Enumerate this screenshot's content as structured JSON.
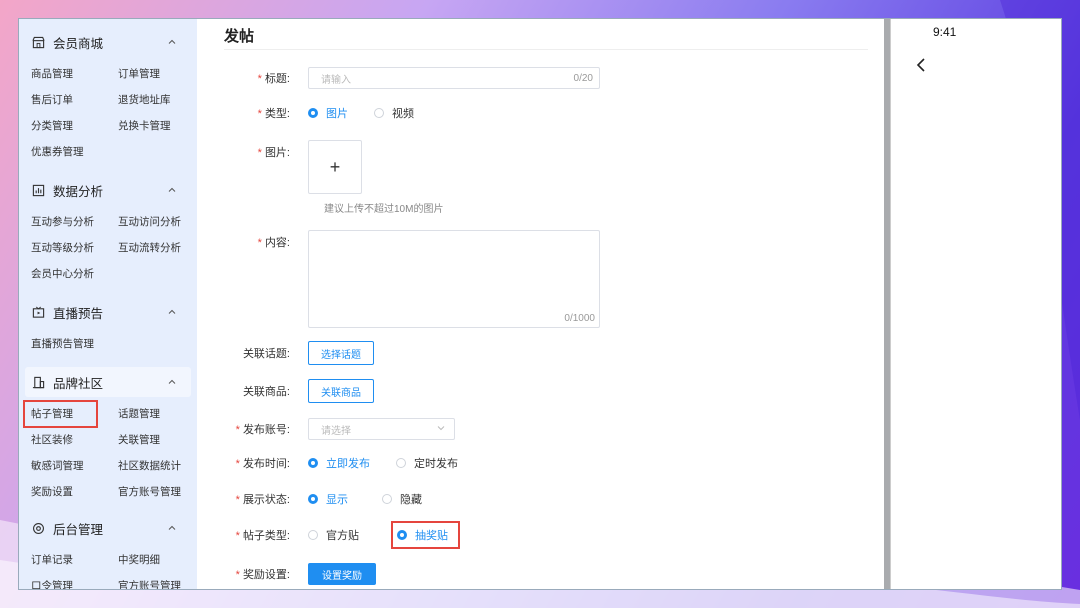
{
  "sidebar": {
    "groups": [
      {
        "title": "会员商城",
        "icon": "store-icon",
        "items": [
          "商品管理",
          "订单管理",
          "售后订单",
          "退货地址库",
          "分类管理",
          "兑换卡管理",
          "优惠券管理"
        ]
      },
      {
        "title": "数据分析",
        "icon": "chart-icon",
        "items": [
          "互动参与分析",
          "互动访问分析",
          "互动等级分析",
          "互动流转分析",
          "会员中心分析"
        ]
      },
      {
        "title": "直播预告",
        "icon": "tv-icon",
        "items": [
          "直播预告管理"
        ]
      },
      {
        "title": "品牌社区",
        "icon": "building-icon",
        "items": [
          "帖子管理",
          "话题管理",
          "社区装修",
          "关联管理",
          "敏感词管理",
          "社区数据统计",
          "奖励设置",
          "官方账号管理"
        ]
      },
      {
        "title": "后台管理",
        "icon": "gear-icon",
        "items": [
          "订单记录",
          "中奖明细",
          "口令管理",
          "官方账号管理"
        ]
      }
    ]
  },
  "form": {
    "page_title": "发帖",
    "title_label": "标题:",
    "title_placeholder": "请输入",
    "title_count": "0/20",
    "type_label": "类型:",
    "type_opt1": "图片",
    "type_opt2": "视频",
    "image_label": "图片:",
    "upload_plus": "+",
    "upload_hint": "建议上传不超过10M的图片",
    "content_label": "内容:",
    "content_count": "0/1000",
    "topic_label": "关联话题:",
    "topic_btn": "选择话题",
    "product_label": "关联商品:",
    "product_btn": "关联商品",
    "account_label": "发布账号:",
    "account_placeholder": "请选择",
    "time_label": "发布时间:",
    "time_opt1": "立即发布",
    "time_opt2": "定时发布",
    "display_label": "展示状态:",
    "display_opt1": "显示",
    "display_opt2": "隐藏",
    "post_type_label": "帖子类型:",
    "post_type_opt1": "官方贴",
    "post_type_opt2": "抽奖贴",
    "reward_label": "奖励设置:",
    "reward_btn": "设置奖励",
    "required_mark": "*"
  },
  "phone": {
    "time": "9:41"
  },
  "colors": {
    "accent": "#1f8ef1",
    "highlight": "#e5453d",
    "sidebar_bg": "#e6eefd"
  }
}
